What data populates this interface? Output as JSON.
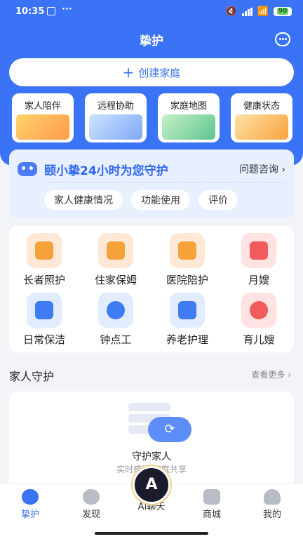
{
  "status": {
    "time": "10:35",
    "dots": "···",
    "battery": "90"
  },
  "header": {
    "title": "挚护"
  },
  "create": {
    "label": "创建家庭",
    "plus": "+"
  },
  "features": [
    {
      "label": "家人陪伴"
    },
    {
      "label": "远程协助"
    },
    {
      "label": "家庭地图"
    },
    {
      "label": "健康状态"
    }
  ],
  "assistant": {
    "headline": "颐小挚24小时为您守护",
    "consult": "问题咨询 ›",
    "pills": [
      "家人健康情况",
      "功能使用",
      "评价"
    ]
  },
  "services": [
    {
      "label": "长者照护",
      "icon": "elder-care-icon"
    },
    {
      "label": "住家保姆",
      "icon": "home-nanny-icon"
    },
    {
      "label": "医院陪护",
      "icon": "hospital-escort-icon"
    },
    {
      "label": "月嫂",
      "icon": "maternity-nurse-icon"
    },
    {
      "label": "日常保洁",
      "icon": "broom-icon"
    },
    {
      "label": "钟点工",
      "icon": "clock-icon"
    },
    {
      "label": "养老护理",
      "icon": "elderly-home-icon"
    },
    {
      "label": "育儿嫂",
      "icon": "baby-face-icon"
    }
  ],
  "family_guard": {
    "title": "家人守护",
    "more": "查看更多 ›",
    "card_title": "守护家人",
    "card_sub": "实时感知 家庭共享"
  },
  "tabs": [
    {
      "label": "挚护",
      "icon": "guard-icon",
      "active": true
    },
    {
      "label": "发现",
      "icon": "compass-icon",
      "active": false
    },
    {
      "label": "AI聊天",
      "icon": "ai-chat-icon",
      "active": false
    },
    {
      "label": "商城",
      "icon": "store-icon",
      "active": false
    },
    {
      "label": "我的",
      "icon": "profile-icon",
      "active": false
    }
  ],
  "colors": {
    "primary": "#3a73f6",
    "background": "#f3f4f8"
  }
}
